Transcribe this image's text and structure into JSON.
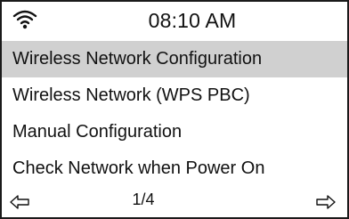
{
  "status_bar": {
    "icon": "wifi-icon",
    "time": "08:10 AM"
  },
  "menu": {
    "items": [
      {
        "label": "Wireless Network Configuration",
        "selected": true
      },
      {
        "label": "Wireless Network (WPS PBC)",
        "selected": false
      },
      {
        "label": "Manual Configuration",
        "selected": false
      },
      {
        "label": "Check Network when Power On",
        "selected": false
      }
    ]
  },
  "footer": {
    "prev_icon": "arrow-left-icon",
    "page": "1/4",
    "next_icon": "arrow-right-icon"
  },
  "colors": {
    "selected_bg": "#d0d0d0",
    "border": "#1a1a1a",
    "text": "#111111"
  }
}
